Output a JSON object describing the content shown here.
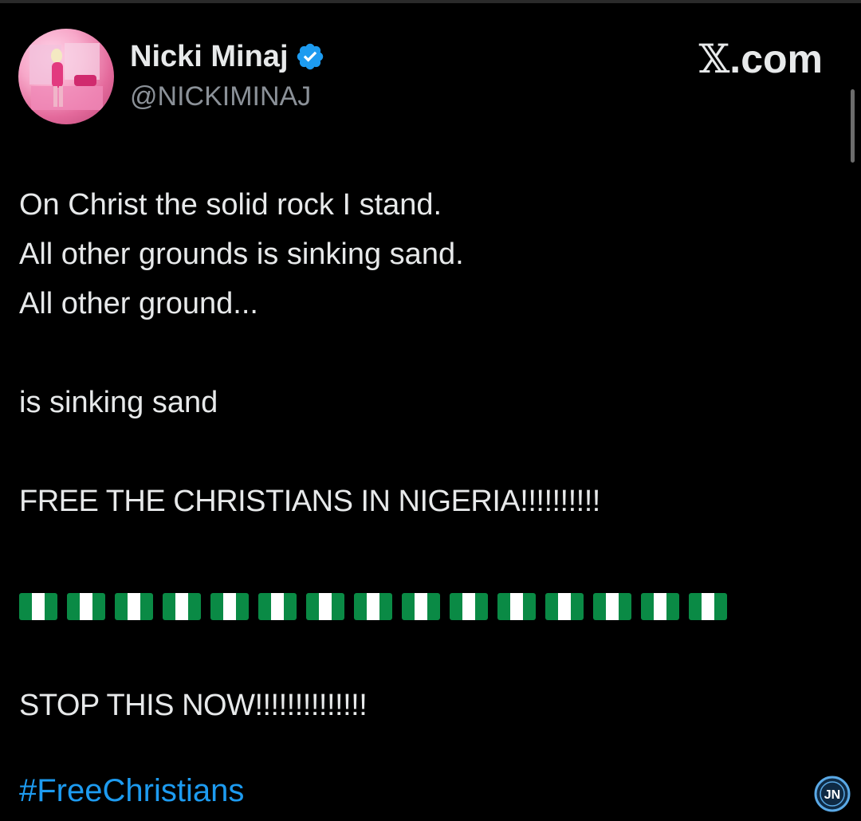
{
  "author": {
    "display_name": "Nicki Minaj",
    "handle": "@NICKIMINAJ",
    "verified_icon": "verified-badge-icon"
  },
  "brand": {
    "x_glyph": "𝕏",
    "suffix": ".com"
  },
  "post": {
    "lines": [
      "On Christ the solid rock I stand.",
      "All other grounds is sinking sand.",
      "All other ground...",
      "is sinking sand",
      "FREE THE CHRISTIANS IN NIGERIA!!!!!!!!!!",
      "STOP THIS NOW!!!!!!!!!!!!!!"
    ],
    "flag_count": 15,
    "flag_icon": "nigeria-flag-icon",
    "hashtag": "#FreeChristians"
  },
  "colors": {
    "background": "#000000",
    "text": "#e7e9ea",
    "handle": "#8b9198",
    "link": "#1d9bf0",
    "verified": "#1d9bf0"
  },
  "watermark": {
    "text": "JN"
  }
}
